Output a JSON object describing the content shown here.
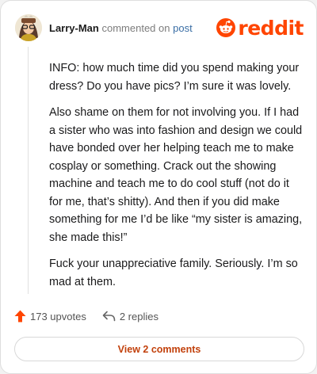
{
  "comment": {
    "username": "Larry-Man",
    "verb": "commented on",
    "target": "post",
    "paragraphs": [
      "INFO: how much time did you spend making your dress? Do you have pics? I’m sure it was lovely.",
      "Also shame on them for not involving you. If I had a sister who was into fashion and design we could have bonded over her helping teach me to make cosplay or something. Crack out the showing machine and teach me to do cool stuff (not do it for me, that’s shitty). And then if you did make something for me I’d be like “my sister is amazing, she made this!”",
      "Fuck your unappreciative family. Seriously. I’m so mad at them."
    ]
  },
  "brand": {
    "logo_text": "reddit",
    "color": "#ff4500"
  },
  "actions": {
    "upvotes": "173 upvotes",
    "replies": "2 replies"
  },
  "footer": {
    "view_button": "View 2 comments"
  },
  "icons": {
    "upvote": "upvote-arrow-icon",
    "reply": "reply-arrow-icon",
    "logo": "reddit-snoo-icon"
  }
}
